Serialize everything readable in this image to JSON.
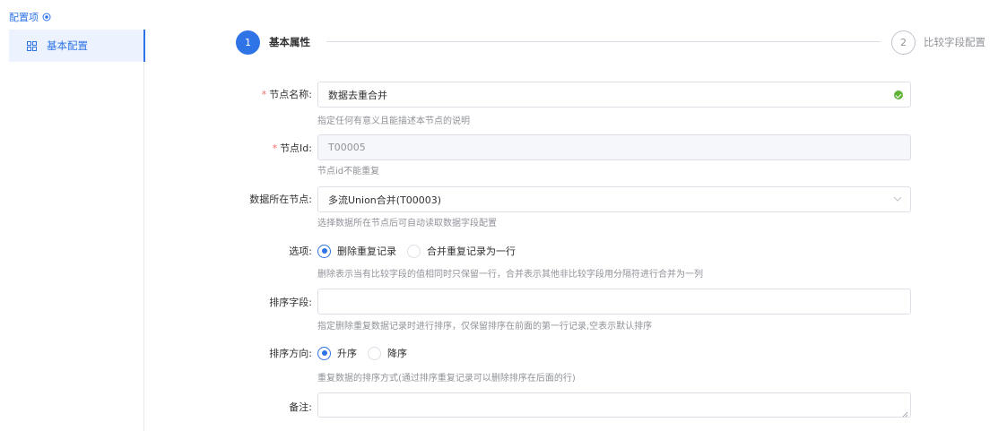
{
  "sidebar": {
    "title": "配置项",
    "title_icon": "target-icon",
    "items": [
      {
        "label": "基本配置",
        "icon": "grid-icon",
        "active": true
      }
    ]
  },
  "steps": [
    {
      "number": "1",
      "label": "基本属性",
      "active": true
    },
    {
      "number": "2",
      "label": "比较字段配置",
      "active": false
    }
  ],
  "form": {
    "node_name": {
      "label": "节点名称:",
      "required": true,
      "value": "数据去重合并",
      "hint": "指定任何有意义且能描述本节点的说明"
    },
    "node_id": {
      "label": "节点Id:",
      "required": true,
      "value": "T00005",
      "hint": "节点id不能重复"
    },
    "source_node": {
      "label": "数据所在节点:",
      "value": "多流Union合并(T00003)",
      "hint": "选择数据所在节点后可自动读取数据字段配置"
    },
    "options": {
      "label": "选项:",
      "choices": [
        "删除重复记录",
        "合并重复记录为一行"
      ],
      "selected": 0,
      "hint": "删除表示当有比较字段的值相同时只保留一行，合并表示其他非比较字段用分隔符进行合并为一列"
    },
    "sort_field": {
      "label": "排序字段:",
      "value": "",
      "hint": "指定删除重复数据记录时进行排序，仅保留排序在前面的第一行记录,空表示默认排序"
    },
    "sort_direction": {
      "label": "排序方向:",
      "choices": [
        "升序",
        "降序"
      ],
      "selected": 0,
      "hint": "重复数据的排序方式(通过排序重复记录可以删除排序在后面的行)"
    },
    "remark": {
      "label": "备注:",
      "value": ""
    }
  },
  "colors": {
    "accent": "#2f74e6",
    "required": "#f56c6c",
    "success": "#5fb335",
    "hint": "#909399"
  }
}
